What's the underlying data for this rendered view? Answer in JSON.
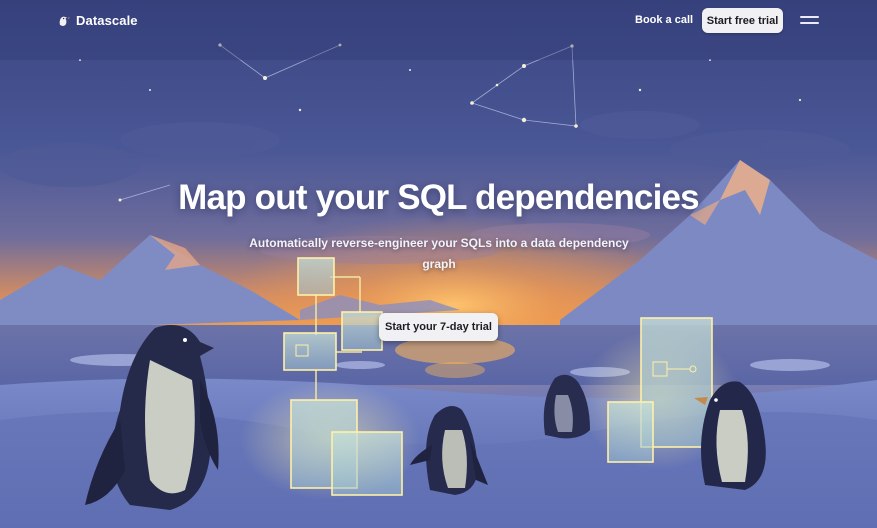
{
  "nav": {
    "brand": "Datascale",
    "book_call": "Book a call",
    "start_trial": "Start free trial",
    "menu_icon": "hamburger-menu-icon",
    "logo_icon": "datascale-logo-icon"
  },
  "hero": {
    "title": "Map out your SQL dependencies",
    "subtitle": "Automatically reverse-engineer your SQLs into a data dependency graph",
    "cta": "Start your 7-day trial",
    "illustration": "penguins-glowing-dependency-graph-illustration"
  },
  "colors": {
    "sky_top": "#3b4682",
    "horizon_glow": "#f19a47",
    "snow": "#7f8fce",
    "button_bg": "#f1f1f3",
    "glow_box": "#dfe9a9"
  }
}
